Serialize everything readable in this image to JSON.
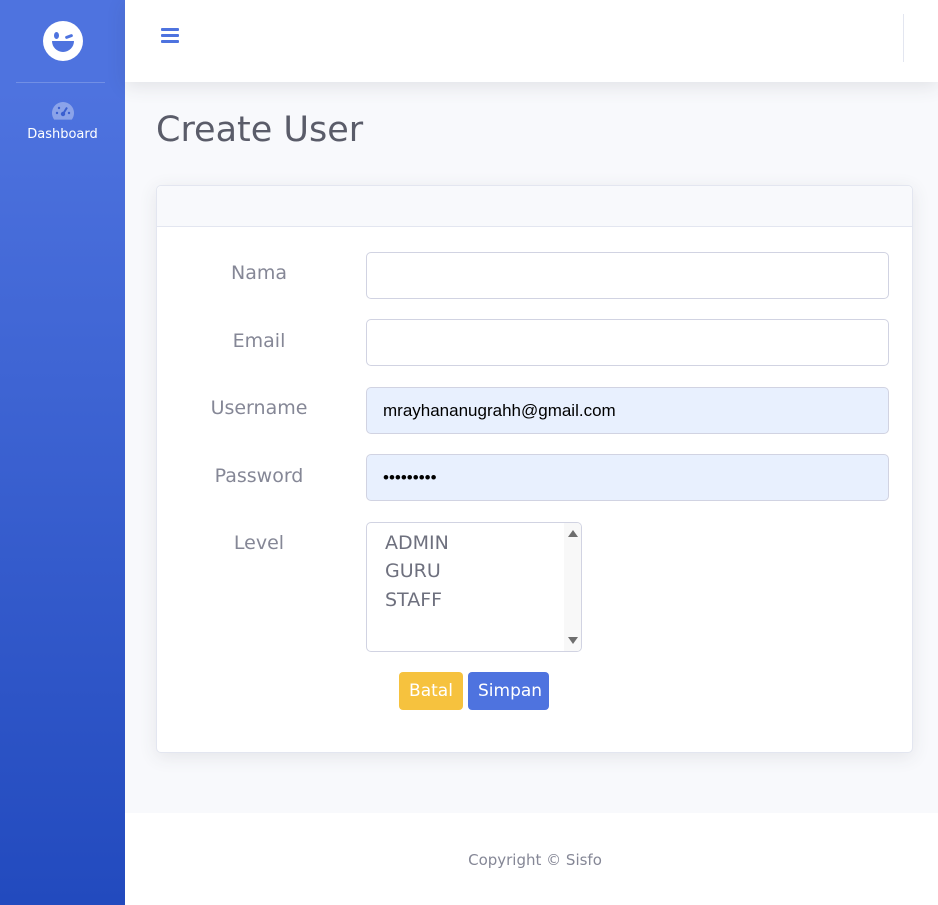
{
  "sidebar": {
    "brand_icon": "winking-face-icon",
    "items": [
      {
        "icon": "tachometer-icon",
        "label": "Dashboard"
      }
    ]
  },
  "topbar": {
    "menu_icon": "hamburger-icon"
  },
  "page": {
    "title": "Create User"
  },
  "form": {
    "nama": {
      "label": "Nama",
      "value": ""
    },
    "email": {
      "label": "Email",
      "value": ""
    },
    "username": {
      "label": "Username",
      "value": "mrayhananugrahh@gmail.com"
    },
    "password": {
      "label": "Password",
      "value": "•••••••••"
    },
    "level": {
      "label": "Level",
      "options": [
        "ADMIN",
        "GURU",
        "STAFF"
      ]
    },
    "cancel_label": "Batal",
    "save_label": "Simpan"
  },
  "footer": {
    "copyright": "Copyright © Sisfo"
  },
  "colors": {
    "primary": "#4e73df",
    "warning": "#f6c23e",
    "autofill": "#e8f0fe"
  }
}
